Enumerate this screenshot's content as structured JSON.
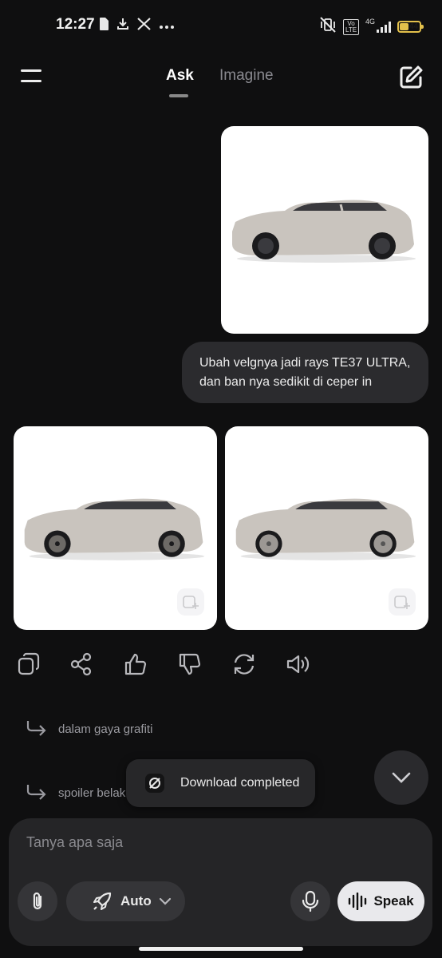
{
  "status_bar": {
    "time": "12:27",
    "network": "4G",
    "volte": "Vo LTE",
    "battery": "44",
    "battery_level": 0.44,
    "icons": [
      "sim-card-icon",
      "download-icon",
      "x-logo-icon",
      "more-dots-icon",
      "silent-vibrate-icon",
      "signal-icon",
      "battery-icon"
    ]
  },
  "header": {
    "tabs": [
      {
        "label": "Ask",
        "active": true
      },
      {
        "label": "Imagine",
        "active": false
      }
    ],
    "icons": [
      "menu-icon",
      "new-chat-edit-icon"
    ]
  },
  "conversation": {
    "user_message": "Ubah velgnya jadi rays TE37 ULTRA, dan ban nya sedikit di ceper in",
    "car_color": "#c9c4be",
    "actions": [
      "copy-icon",
      "share-icon",
      "thumbs-up-icon",
      "thumbs-down-icon",
      "regenerate-icon",
      "speaker-icon"
    ]
  },
  "suggestions": [
    {
      "label": "dalam gaya grafiti"
    },
    {
      "label": "spoiler belak"
    }
  ],
  "toast": {
    "text": "Download completed"
  },
  "composer": {
    "placeholder": "Tanya apa saja",
    "mode_label": "Auto",
    "speak_label": "Speak"
  },
  "colors": {
    "background": "#0f0f10",
    "bubble": "#2b2b2e",
    "composer": "#252527",
    "battery": "#e2c04b"
  }
}
